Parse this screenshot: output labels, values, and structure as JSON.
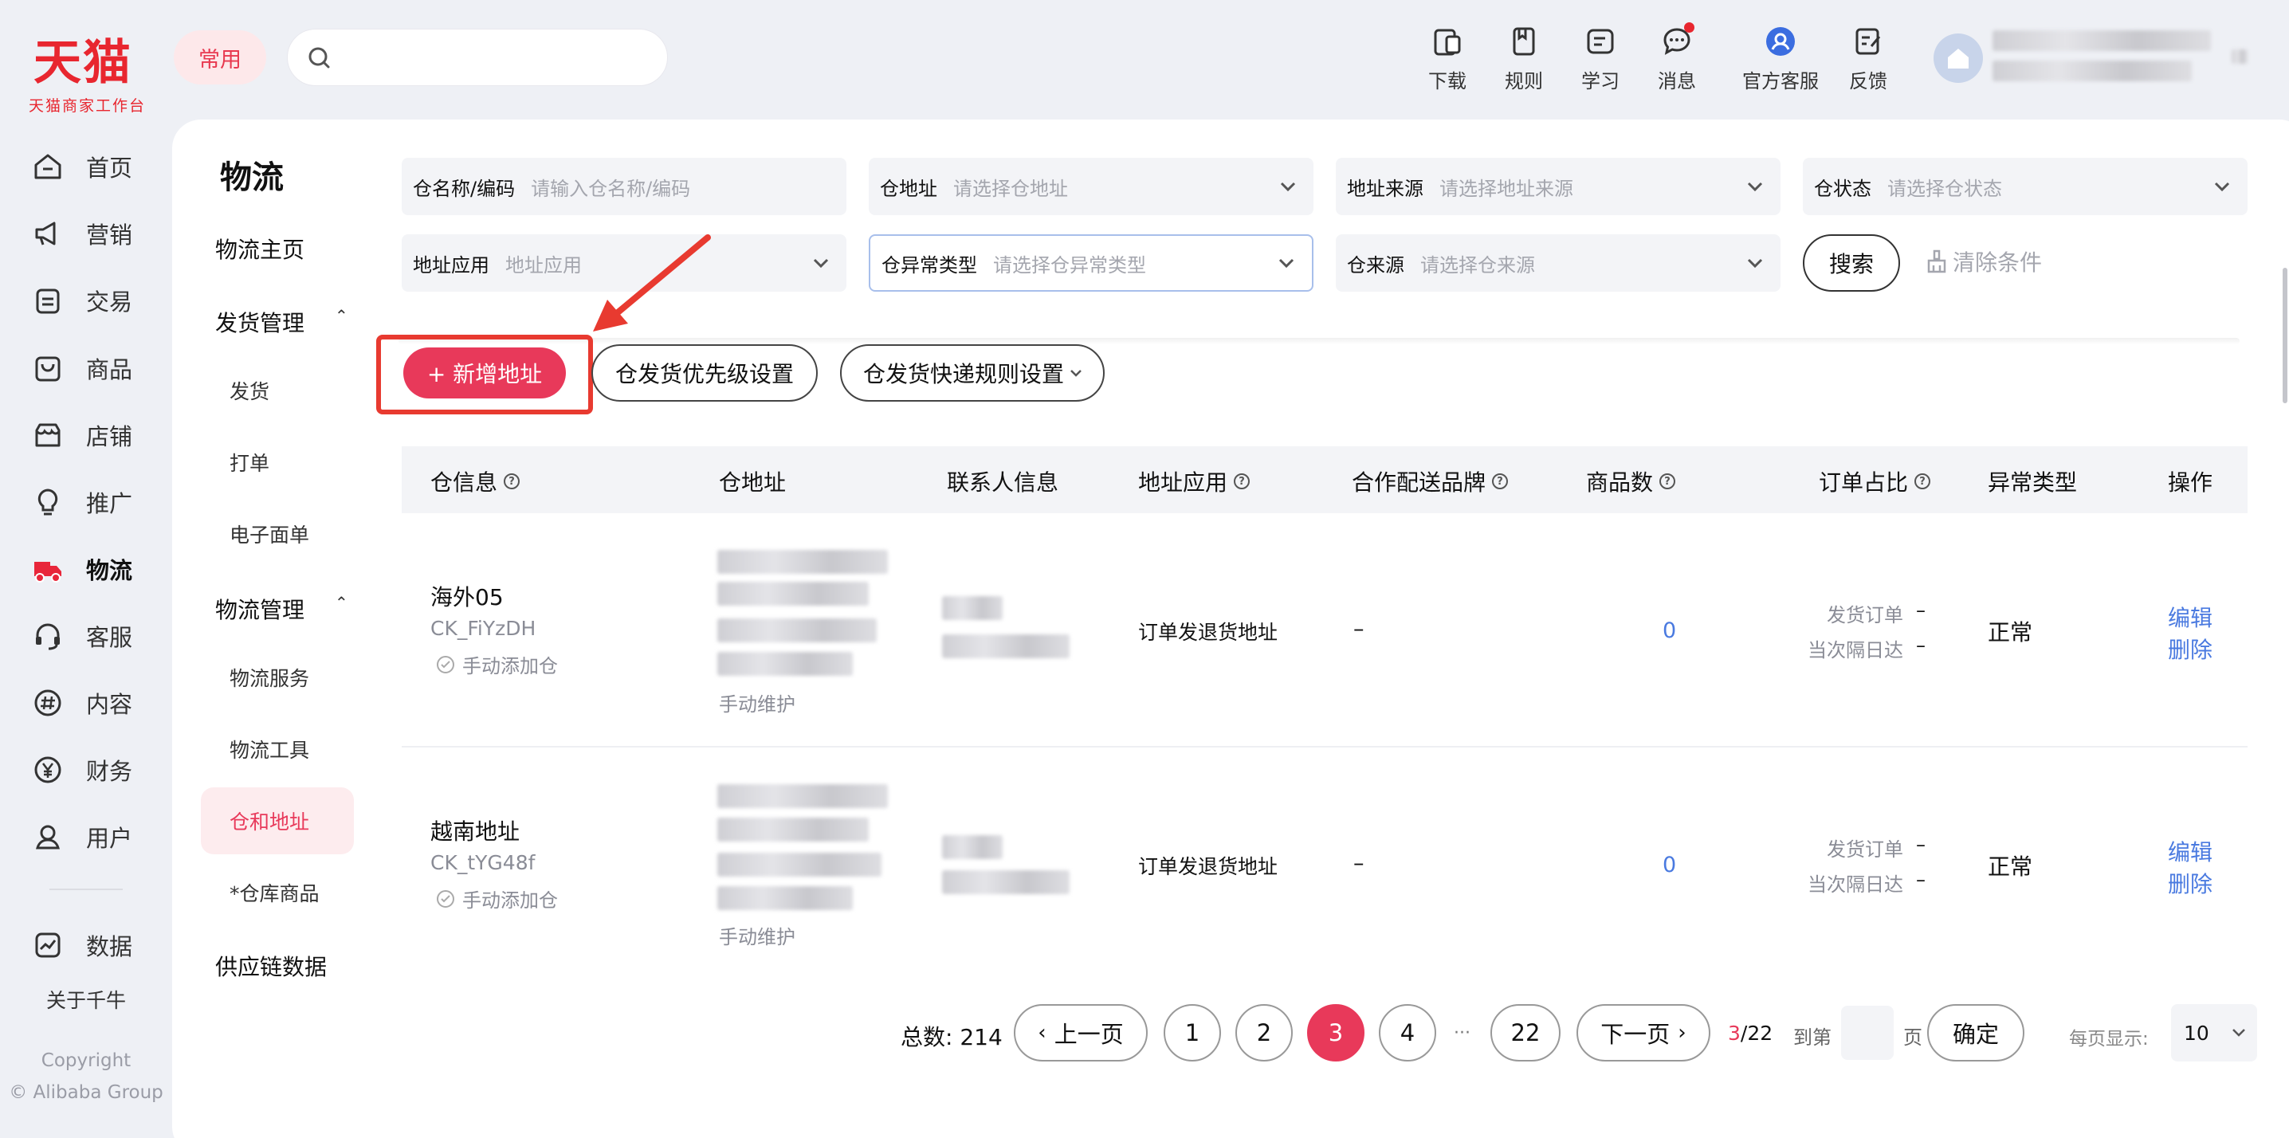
{
  "logo": {
    "main": "天猫",
    "sub": "天猫商家工作台"
  },
  "header": {
    "common_label": "常用",
    "search": {
      "value": "",
      "placeholder": ""
    },
    "toolbar": [
      {
        "label": "下载",
        "icon": "phone-download-icon"
      },
      {
        "label": "规则",
        "icon": "book-icon"
      },
      {
        "label": "学习",
        "icon": "learn-icon"
      },
      {
        "label": "消息",
        "icon": "message-icon",
        "badge": true
      },
      {
        "label": "官方客服",
        "icon": "customer-service-icon"
      },
      {
        "label": "反馈",
        "icon": "feedback-icon"
      }
    ]
  },
  "sidebar": {
    "items": [
      {
        "label": "首页",
        "icon": "home-icon"
      },
      {
        "label": "营销",
        "icon": "megaphone-icon"
      },
      {
        "label": "交易",
        "icon": "transaction-icon"
      },
      {
        "label": "商品",
        "icon": "product-icon"
      },
      {
        "label": "店铺",
        "icon": "shop-icon"
      },
      {
        "label": "推广",
        "icon": "bulb-icon"
      },
      {
        "label": "物流",
        "icon": "truck-icon",
        "active": true
      },
      {
        "label": "客服",
        "icon": "headset-icon"
      },
      {
        "label": "内容",
        "icon": "hash-icon"
      },
      {
        "label": "财务",
        "icon": "yen-icon"
      },
      {
        "label": "用户",
        "icon": "user-icon"
      },
      {
        "label": "数据",
        "icon": "chart-icon"
      }
    ],
    "about": "关于千牛",
    "copyright_1": "Copyright",
    "copyright_2": "© Alibaba Group"
  },
  "subnav": {
    "title": "物流",
    "home": "物流主页",
    "group1": "发货管理",
    "group1_items": [
      "发货",
      "打单",
      "电子面单"
    ],
    "group2": "物流管理",
    "group2_items": [
      "物流服务",
      "物流工具",
      "仓和地址",
      "*仓库商品"
    ],
    "active_item": "仓和地址",
    "supply": "供应链数据"
  },
  "filters": {
    "warehouse_name": {
      "label": "仓名称/编码",
      "placeholder": "请输入仓名称/编码"
    },
    "warehouse_address": {
      "label": "仓地址",
      "placeholder": "请选择仓地址"
    },
    "address_source": {
      "label": "地址来源",
      "placeholder": "请选择地址来源"
    },
    "warehouse_status": {
      "label": "仓状态",
      "placeholder": "请选择仓状态"
    },
    "address_usage": {
      "label": "地址应用",
      "placeholder": "地址应用"
    },
    "exception_type": {
      "label": "仓异常类型",
      "placeholder": "请选择仓异常类型"
    },
    "warehouse_origin": {
      "label": "仓来源",
      "placeholder": "请选择仓来源"
    },
    "search_button": "搜索",
    "clear_button": "清除条件"
  },
  "actions": {
    "add_address": "+ 新增地址",
    "priority_setting": "仓发货优先级设置",
    "express_rules": "仓发货快递规则设置"
  },
  "table": {
    "headers": [
      "仓信息",
      "仓地址",
      "联系人信息",
      "地址应用",
      "合作配送品牌",
      "商品数",
      "订单占比",
      "异常类型",
      "操作"
    ],
    "rows": [
      {
        "name": "海外05",
        "code": "CK_FiYzDH",
        "origin": "手动添加仓",
        "address_note": "手动维护",
        "usage": "订单发退货地址",
        "brand": "–",
        "goods_count": "0",
        "ship_order_label": "发货订单",
        "ship_order_value": "–",
        "next_day_label": "当次隔日达",
        "next_day_value": "–",
        "exception": "正常",
        "edit": "编辑",
        "delete": "删除"
      },
      {
        "name": "越南地址",
        "code": "CK_tYG48f",
        "origin": "手动添加仓",
        "address_note": "手动维护",
        "usage": "订单发退货地址",
        "brand": "–",
        "goods_count": "0",
        "ship_order_label": "发货订单",
        "ship_order_value": "–",
        "next_day_label": "当次隔日达",
        "next_day_value": "–",
        "exception": "正常",
        "edit": "编辑",
        "delete": "删除"
      }
    ]
  },
  "pagination": {
    "total": "总数: 214",
    "prev": "上一页",
    "pages": [
      "1",
      "2",
      "3",
      "4"
    ],
    "ellipsis": "···",
    "last": "22",
    "next": "下一页",
    "current": "3",
    "of_total": "/22",
    "goto_label": "到第",
    "page_unit": "页",
    "confirm": "确定",
    "per_page_label": "每页显示:",
    "per_page_value": "10"
  },
  "colors": {
    "brand_red": "#e8262f",
    "accent_pink": "#e8395a",
    "link_blue": "#4a7ae0",
    "annotation_red": "#e83a30"
  }
}
